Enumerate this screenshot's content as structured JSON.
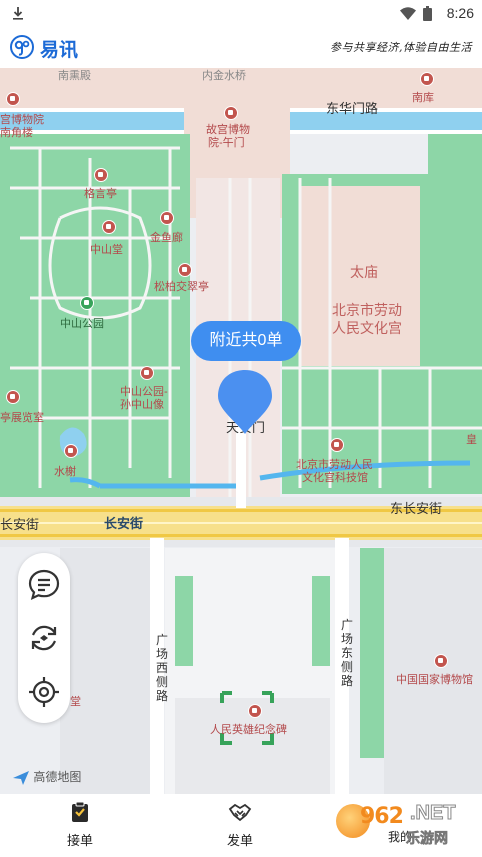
{
  "status_bar": {
    "time": "8:26"
  },
  "header": {
    "app_name": "易讯",
    "slogan": "参与共享经济,体验自由生活"
  },
  "map": {
    "bubble_text": "附近共0单",
    "attribution": "高德地图",
    "labels": {
      "nanxundian": "南熏殿",
      "neijinshuiqiao": "内金水桥",
      "nanku": "南库",
      "gugong_nanjiaolou_1": "宫博物院",
      "gugong_nanjiaolou_2": "南角楼",
      "donghuamen": "东华门路",
      "wumen_1": "故宫博物",
      "wumen_2": "院-午门",
      "geyanting": "格言亭",
      "zhongshantang": "中山堂",
      "jinyulang": "金鱼廊",
      "songbai": "松柏交翠亭",
      "taimiao": "太庙",
      "wenhuagong_1": "北京市劳动",
      "wenhuagong_2": "人民文化宫",
      "zhongshangongyuan": "中山公园",
      "xiang_1": "中山公园-",
      "xiang_2": "孙中山像",
      "zhanlanshi": "亭展览室",
      "tiananmen": "天安门",
      "huang": "皇",
      "shuixie": "水榭",
      "keji_1": "北京市劳动人民",
      "keji_2": "文化宫科技馆",
      "changanjie_w": "长安街",
      "changanjie": "长安街",
      "dongchanganjie": "东长安街",
      "guangchang_xi": "广场西侧路",
      "guangchang_dong": "广场东侧路",
      "museum": "中国国家博物馆",
      "jinianbei": "人民英雄纪念碑",
      "tang": "堂"
    }
  },
  "tools": [
    {
      "name": "message-icon"
    },
    {
      "name": "refresh-location-icon"
    },
    {
      "name": "locate-icon"
    }
  ],
  "bottom_nav": {
    "items": [
      {
        "label": "接单"
      },
      {
        "label": "发单"
      },
      {
        "label": "我的"
      }
    ],
    "watermark": {
      "num": "962",
      "net": ".NET",
      "sub": "乐游网"
    }
  }
}
